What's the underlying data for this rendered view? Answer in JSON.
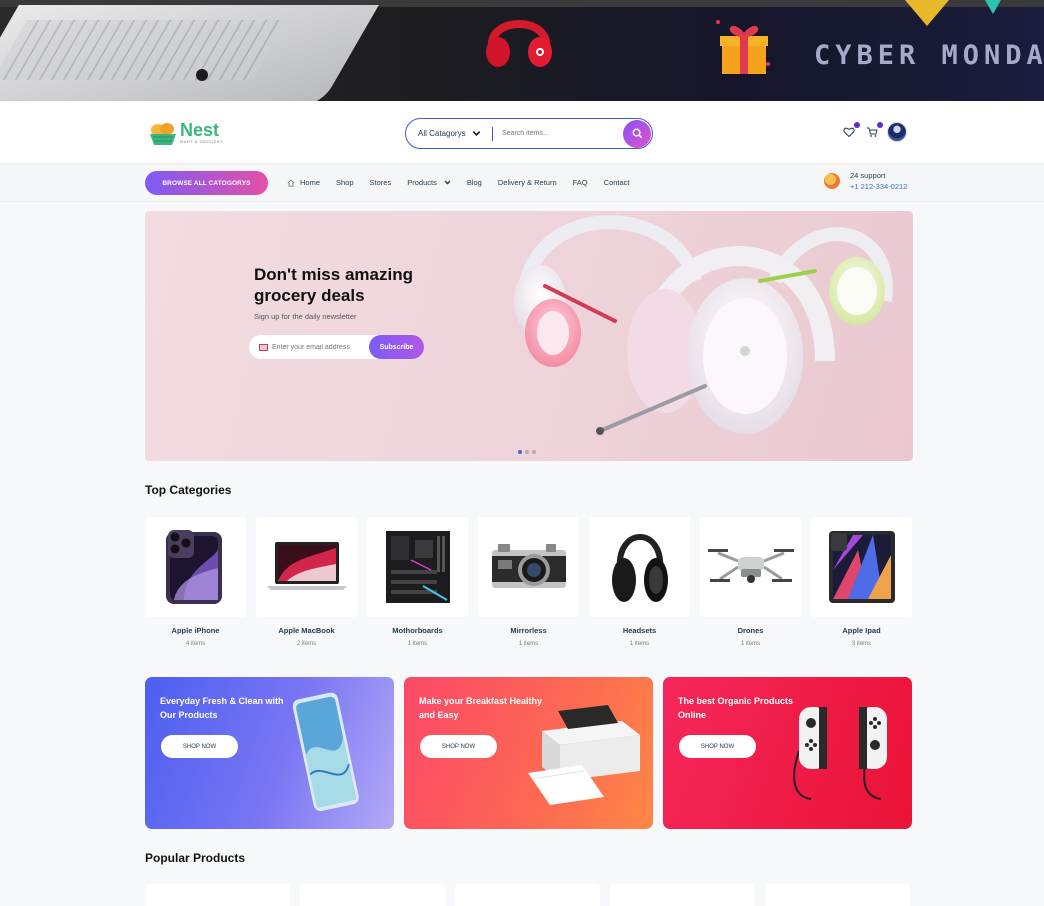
{
  "promo_banner": {
    "text": "CYBER MONDAY S"
  },
  "header": {
    "logo_name": "Nest",
    "logo_tagline": "MART & GROCERY",
    "search": {
      "category": "All Catagorys",
      "placeholder": "Search items..."
    }
  },
  "nav": {
    "browse_label": "BROWSE ALL CATOGORYS",
    "items": [
      {
        "label": "Home",
        "icon": "home-icon"
      },
      {
        "label": "Shop"
      },
      {
        "label": "Stores"
      },
      {
        "label": "Products",
        "icon": "chevron-down-icon"
      },
      {
        "label": "Blog"
      },
      {
        "label": "Delivery & Return"
      },
      {
        "label": "FAQ"
      },
      {
        "label": "Contact"
      }
    ],
    "support": {
      "title": "24 support",
      "phone": "+1 212-334-0212"
    }
  },
  "hero": {
    "title": "Don't miss amazing grocery deals",
    "subtitle": "Sign up for the daily newsletter",
    "email_placeholder": "Enter your email address",
    "subscribe_label": "Subscribe",
    "slides": 3,
    "active_slide": 1
  },
  "categories": {
    "title": "Top Categories",
    "items": [
      {
        "name": "Apple iPhone",
        "count": "4 items",
        "icon": "iphone-icon"
      },
      {
        "name": "Apple MacBook",
        "count": "2 items",
        "icon": "macbook-icon"
      },
      {
        "name": "Mothorboards",
        "count": "1 items",
        "icon": "motherboard-icon"
      },
      {
        "name": "Mirrorless",
        "count": "1 items",
        "icon": "camera-icon"
      },
      {
        "name": "Headsets",
        "count": "1 items",
        "icon": "headset-icon"
      },
      {
        "name": "Drones",
        "count": "1 items",
        "icon": "drone-icon"
      },
      {
        "name": "Apple Ipad",
        "count": "3 items",
        "icon": "ipad-icon"
      }
    ]
  },
  "promo_cards": [
    {
      "title": "Everyday Fresh & Clean with Our Products",
      "button": "SHOP NOW"
    },
    {
      "title": "Make your Breakfast Healthy and Easy",
      "button": "SHOP NOW"
    },
    {
      "title": "The best Organic Products Online",
      "button": "SHOP NOW"
    }
  ],
  "popular": {
    "title": "Popular Products"
  },
  "colors": {
    "brand": "#3bb77e",
    "accent_gradient_start": "#7b5cf5",
    "accent_gradient_end": "#e54fa8",
    "search_border": "#3b5bd9"
  }
}
